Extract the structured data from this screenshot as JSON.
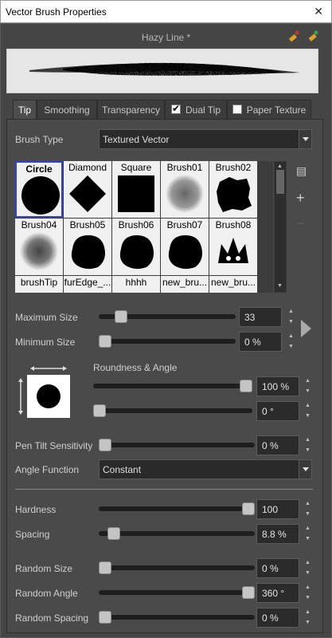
{
  "window": {
    "title": "Vector Brush Properties",
    "close": "✕"
  },
  "brush_name": "Hazy Line *",
  "tabs": [
    {
      "label": "Tip",
      "active": true
    },
    {
      "label": "Smoothing"
    },
    {
      "label": "Transparency"
    },
    {
      "label": "Dual Tip",
      "checked": true
    },
    {
      "label": "Paper Texture",
      "checked": false
    }
  ],
  "brush_type": {
    "label": "Brush Type",
    "value": "Textured Vector"
  },
  "tips": [
    {
      "name": "Circle",
      "shape": "circle",
      "selected": true
    },
    {
      "name": "Diamond",
      "shape": "diamond"
    },
    {
      "name": "Square",
      "shape": "square"
    },
    {
      "name": "Brush01",
      "shape": "fuzzy"
    },
    {
      "name": "Brush02",
      "shape": "splat"
    },
    {
      "name": "Brush04",
      "shape": "grainy"
    },
    {
      "name": "Brush05",
      "shape": "blob"
    },
    {
      "name": "Brush06",
      "shape": "blob"
    },
    {
      "name": "Brush07",
      "shape": "blob"
    },
    {
      "name": "Brush08",
      "shape": "crown"
    },
    {
      "name": "brushTip",
      "shape": "none"
    },
    {
      "name": "furEdge_...",
      "shape": "none"
    },
    {
      "name": "hhhh",
      "shape": "none"
    },
    {
      "name": "new_bru...",
      "shape": "none"
    },
    {
      "name": "new_bru...",
      "shape": "none"
    }
  ],
  "side_icons": {
    "menu": "▤",
    "add": "+",
    "remove": "−"
  },
  "max_size": {
    "label": "Maximum Size",
    "value": "33",
    "fraction": 0.13
  },
  "min_size": {
    "label": "Minimum Size",
    "value": "0 %",
    "fraction": 0.0
  },
  "roundness_angle": {
    "label": "Roundness & Angle",
    "roundness": "100 %",
    "roundness_fraction": 1.0,
    "angle": "0 °",
    "angle_fraction": 0.0
  },
  "pen_tilt": {
    "label": "Pen Tilt Sensitivity",
    "value": "0 %",
    "fraction": 0.0
  },
  "angle_function": {
    "label": "Angle Function",
    "value": "Constant"
  },
  "hardness": {
    "label": "Hardness",
    "value": "100",
    "fraction": 1.0
  },
  "spacing": {
    "label": "Spacing",
    "value": "8.8 %",
    "fraction": 0.06
  },
  "random_size": {
    "label": "Random Size",
    "value": "0 %",
    "fraction": 0.0
  },
  "random_angle": {
    "label": "Random Angle",
    "value": "360 °",
    "fraction": 1.0
  },
  "random_spacing": {
    "label": "Random Spacing",
    "value": "0 %",
    "fraction": 0.0
  },
  "spin_glyphs": {
    "up": "▲",
    "down": "▼"
  }
}
